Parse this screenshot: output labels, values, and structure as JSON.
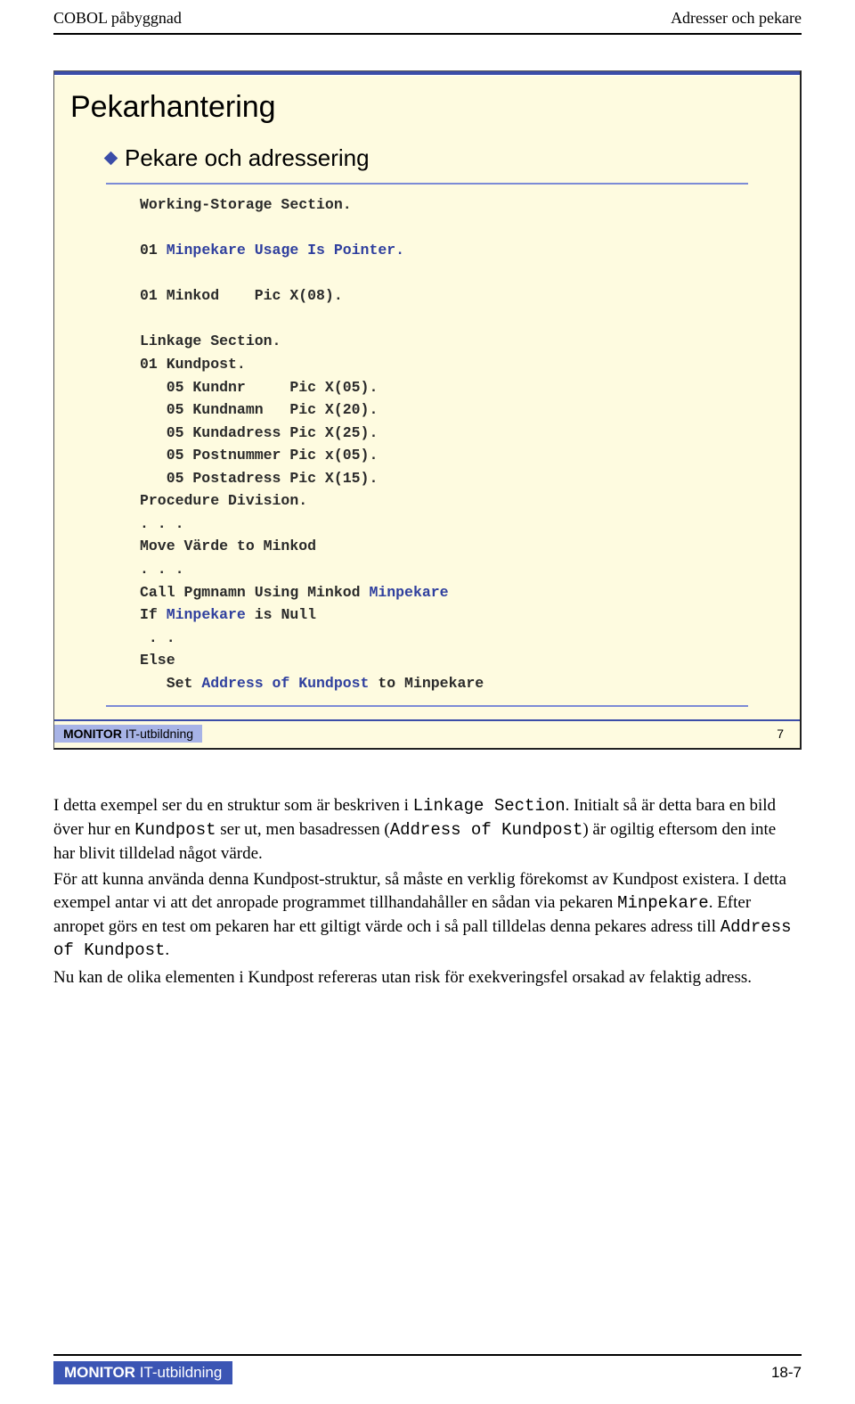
{
  "header": {
    "left": "COBOL påbyggnad",
    "right": "Adresser och pekare"
  },
  "slide": {
    "title": "Pekarhantering",
    "bullet": "Pekare och adressering",
    "code_lines": [
      {
        "segs": [
          {
            "t": "Working-Storage Section."
          }
        ]
      },
      {
        "segs": [
          {
            "t": ""
          }
        ]
      },
      {
        "segs": [
          {
            "t": "01 "
          },
          {
            "t": "Minpekare Usage Is Pointer.",
            "c": "hl1"
          }
        ]
      },
      {
        "segs": [
          {
            "t": ""
          }
        ]
      },
      {
        "segs": [
          {
            "t": "01 Minkod    Pic X(08)."
          }
        ]
      },
      {
        "segs": [
          {
            "t": ""
          }
        ]
      },
      {
        "segs": [
          {
            "t": "Linkage Section."
          }
        ]
      },
      {
        "segs": [
          {
            "t": "01 Kundpost."
          }
        ]
      },
      {
        "segs": [
          {
            "t": "   05 Kundnr     Pic X(05)."
          }
        ]
      },
      {
        "segs": [
          {
            "t": "   05 Kundnamn   Pic X(20)."
          }
        ]
      },
      {
        "segs": [
          {
            "t": "   05 Kundadress Pic X(25)."
          }
        ]
      },
      {
        "segs": [
          {
            "t": "   05 Postnummer Pic x(05)."
          }
        ]
      },
      {
        "segs": [
          {
            "t": "   05 Postadress Pic X(15)."
          }
        ]
      },
      {
        "segs": [
          {
            "t": "Procedure Division."
          }
        ]
      },
      {
        "segs": [
          {
            "t": ". . ."
          }
        ]
      },
      {
        "segs": [
          {
            "t": "Move Värde to Minkod"
          }
        ]
      },
      {
        "segs": [
          {
            "t": ". . ."
          }
        ]
      },
      {
        "segs": [
          {
            "t": "Call Pgmnamn Using Minkod "
          },
          {
            "t": "Minpekare",
            "c": "hl1"
          }
        ]
      },
      {
        "segs": [
          {
            "t": "If "
          },
          {
            "t": "Minpekare",
            "c": "hl1"
          },
          {
            "t": " is Null"
          }
        ]
      },
      {
        "segs": [
          {
            "t": " . ."
          }
        ]
      },
      {
        "segs": [
          {
            "t": "Else"
          }
        ]
      },
      {
        "segs": [
          {
            "t": "   Set "
          },
          {
            "t": "Address of Kundpost",
            "c": "hl1"
          },
          {
            "t": " to Minpekare"
          }
        ]
      }
    ],
    "footer_brand_bold": "MONITOR",
    "footer_brand_rest": " IT-utbildning",
    "footer_page": "7"
  },
  "body": {
    "p1_a": "I detta exempel ser du en struktur som är beskriven i ",
    "p1_code1": "Linkage Section",
    "p1_b": ". Initialt så är detta bara en bild över hur en ",
    "p1_code2": "Kundpost",
    "p1_c": " ser ut, men basadressen (",
    "p1_code3": "Address of Kundpost",
    "p1_d": ") är ogiltig eftersom den inte har blivit tilldelad något värde.",
    "p2_a": "För att kunna använda denna Kundpost-struktur, så måste en verklig förekomst av Kundpost existera. I detta exempel antar vi att det anropade programmet tillhandahåller en sådan via pekaren ",
    "p2_code1": "Minpekare",
    "p2_b": ". Efter anropet görs en test om pekaren har ett giltigt värde och i så pall tilldelas denna pekares adress till ",
    "p2_code2": "Address of Kundpost",
    "p2_c": ".",
    "p3": "Nu kan de olika elementen i Kundpost refereras utan risk för exekveringsfel orsakad av felaktig adress."
  },
  "footer": {
    "brand_bold": "MONITOR",
    "brand_rest": " IT-utbildning",
    "page": "18-7"
  }
}
